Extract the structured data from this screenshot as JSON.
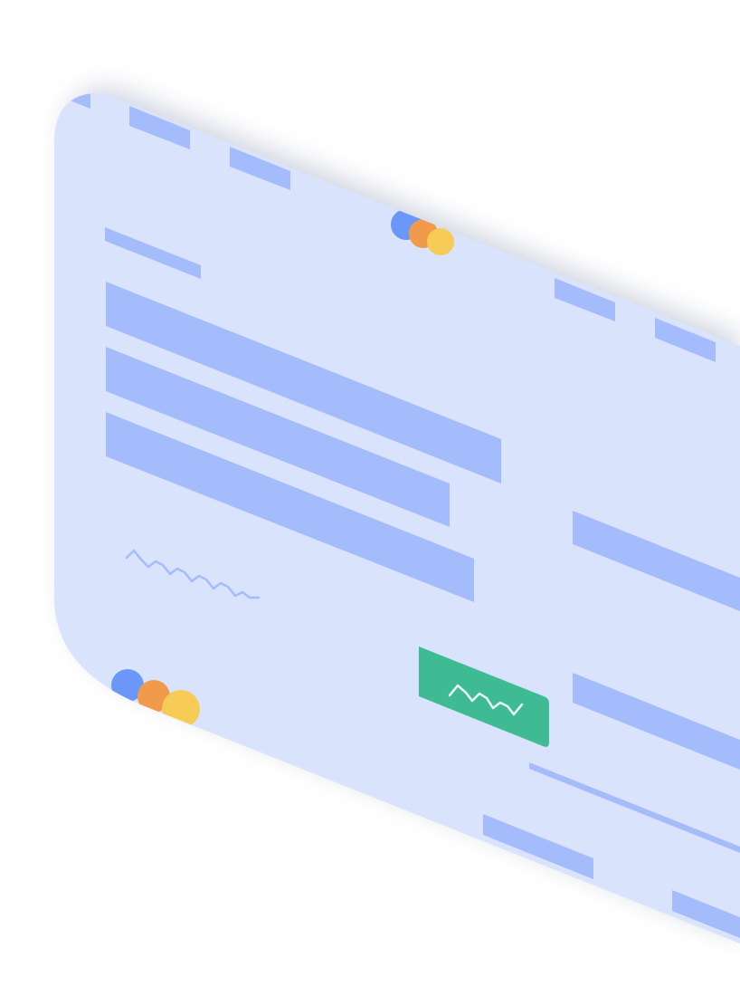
{
  "colors": {
    "background": "#ffffff",
    "card": "#d9e3fc",
    "placeholder": "#a4bcfc",
    "accent_button": "#3fbb94",
    "button_squiggle": "#e8fbf4",
    "dot_blue": "#6b97f8",
    "dot_orange": "#f29a4c",
    "dot_yellow": "#f6cc56",
    "shadow": "#aab3c8"
  },
  "illustration": {
    "style": "isometric wireframe mockup card",
    "text_content": "none",
    "top_dots": [
      "dot-blue-icon",
      "dot-orange-icon",
      "dot-yellow-icon"
    ],
    "bottom_dots": [
      "dot-blue-icon",
      "dot-orange-icon",
      "dot-yellow-icon"
    ],
    "squiggle_icon": "squiggle-icon",
    "button_icon": "squiggle-icon"
  }
}
